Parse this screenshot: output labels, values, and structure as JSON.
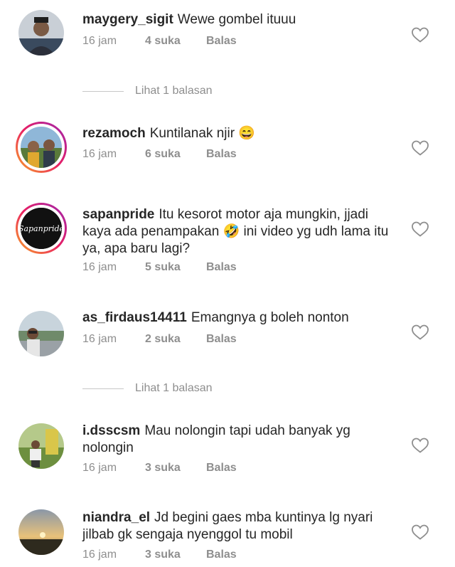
{
  "comments": [
    {
      "username": "maygery_sigit",
      "text": "Wewe gombel ituuu",
      "time": "16 jam",
      "likes": "4 suka",
      "reply": "Balas",
      "avatar_style": "plain"
    },
    {
      "username": "rezamoch",
      "text": "Kuntilanak njir 😄",
      "time": "16 jam",
      "likes": "6 suka",
      "reply": "Balas",
      "avatar_style": "story-ring"
    },
    {
      "username": "sapanpride",
      "text": "Itu kesorot motor aja mungkin, jjadi kaya ada penampakan 🤣 ini video yg udh lama itu ya, apa baru lagi?",
      "time": "16 jam",
      "likes": "5 suka",
      "reply": "Balas",
      "avatar_style": "story-ring",
      "avatar_text": "Sapanpride"
    },
    {
      "username": "as_firdaus14411",
      "text": "Emangnya g boleh nonton",
      "time": "16 jam",
      "likes": "2 suka",
      "reply": "Balas",
      "avatar_style": "plain"
    },
    {
      "username": "i.dsscsm",
      "text": "Mau nolongin tapi udah banyak yg nolongin",
      "time": "16 jam",
      "likes": "3 suka",
      "reply": "Balas",
      "avatar_style": "plain"
    },
    {
      "username": "niandra_el",
      "text": "Jd begini gaes mba kuntinya lg nyari jilbab gk sengaja nyenggol tu mobil",
      "time": "16 jam",
      "likes": "3 suka",
      "reply": "Balas",
      "avatar_style": "plain"
    }
  ],
  "view_replies": [
    "Lihat 1 balasan",
    "Lihat 1 balasan"
  ],
  "icons": {
    "like": "heart-outline-icon"
  },
  "colors": {
    "text": "#262626",
    "secondary": "#8e8e8e",
    "divider": "#c7c7c7"
  }
}
